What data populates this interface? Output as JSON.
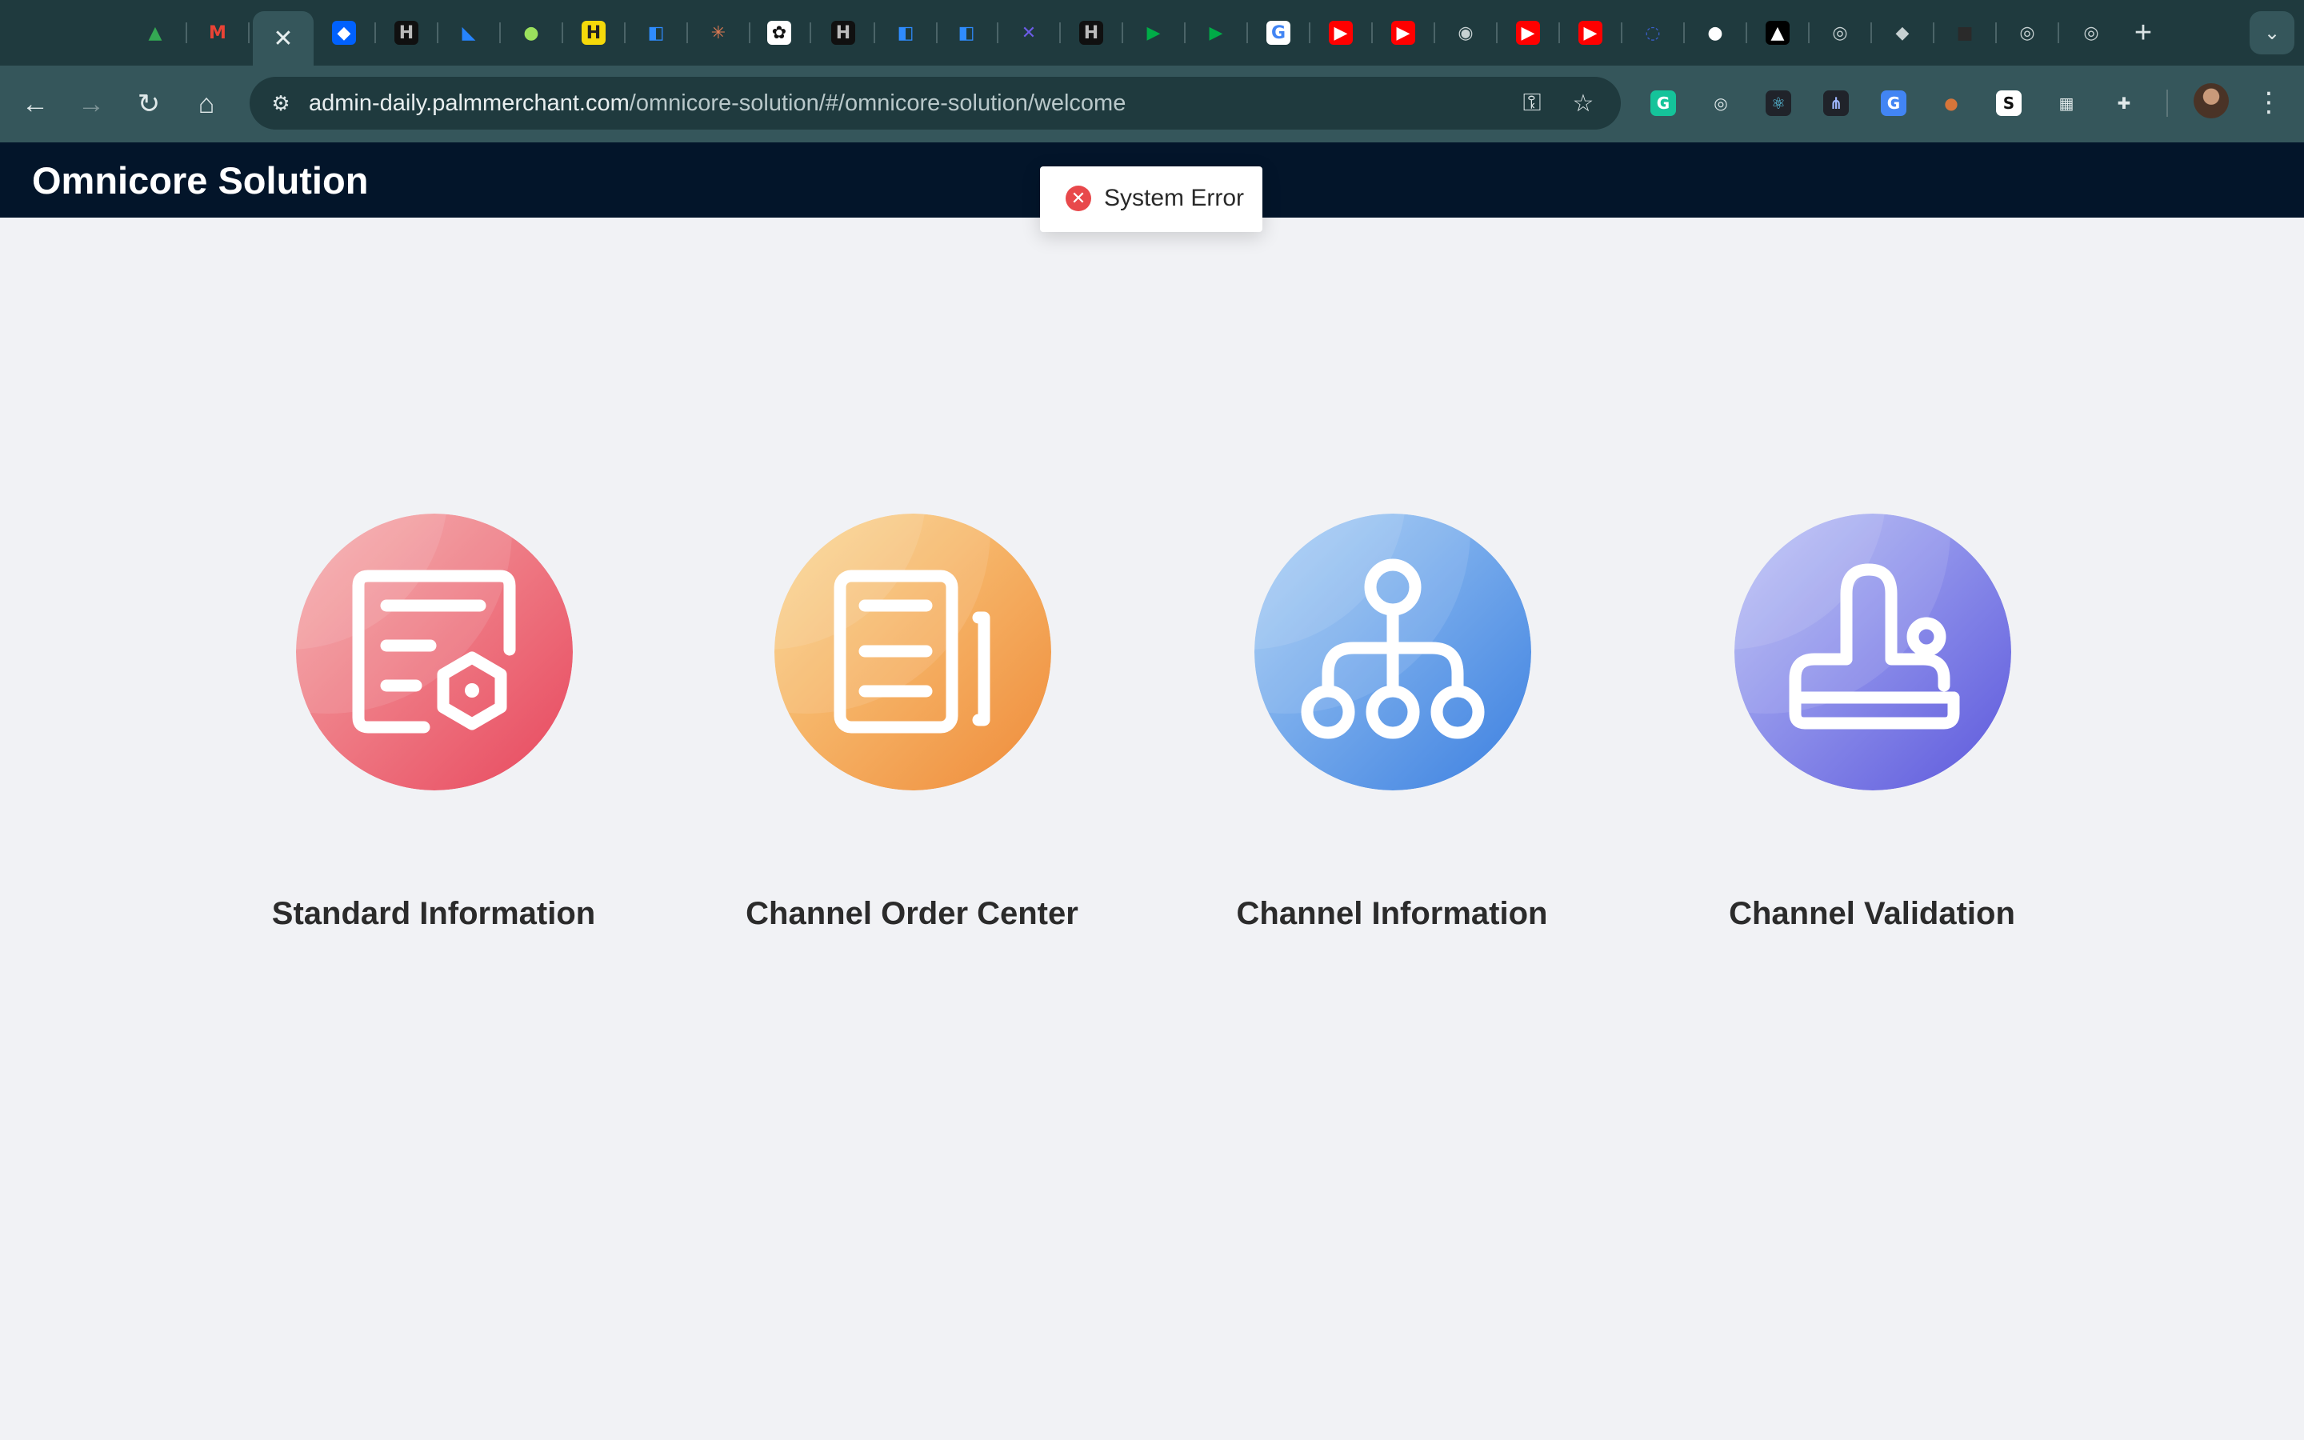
{
  "browser": {
    "active_tab_close": "✕",
    "tabs": [
      {
        "icon": "google-drive-icon",
        "glyph": "▲",
        "bg": "transparent",
        "fg": "#34a853"
      },
      {
        "icon": "gmail-icon",
        "glyph": "M",
        "bg": "transparent",
        "fg": "#ea4335"
      },
      {
        "icon": "dropbox-icon",
        "glyph": "◆",
        "bg": "#0061fe",
        "fg": "#ffffff"
      },
      {
        "icon": "notion-like-icon",
        "glyph": "H",
        "bg": "#101010",
        "fg": "#bbbbbb"
      },
      {
        "icon": "jira-icon",
        "glyph": "◣",
        "bg": "transparent",
        "fg": "#2684ff"
      },
      {
        "icon": "green-globe-icon",
        "glyph": "●",
        "bg": "transparent",
        "fg": "#9be15d"
      },
      {
        "icon": "yellow-h-icon",
        "glyph": "H",
        "bg": "#f5d90a",
        "fg": "#222222"
      },
      {
        "icon": "azure-devops-icon",
        "glyph": "◧",
        "bg": "transparent",
        "fg": "#2f8cff"
      },
      {
        "icon": "asterisk-icon",
        "glyph": "✳",
        "bg": "transparent",
        "fg": "#e07b53"
      },
      {
        "icon": "openai-icon",
        "glyph": "✿",
        "bg": "#ffffff",
        "fg": "#111111"
      },
      {
        "icon": "notion-like-icon",
        "glyph": "H",
        "bg": "#101010",
        "fg": "#bbbbbb"
      },
      {
        "icon": "azure-devops-icon",
        "glyph": "◧",
        "bg": "transparent",
        "fg": "#2f8cff"
      },
      {
        "icon": "azure-devops-icon",
        "glyph": "◧",
        "bg": "transparent",
        "fg": "#2f8cff"
      },
      {
        "icon": "x-cross-icon",
        "glyph": "✕",
        "bg": "transparent",
        "fg": "#6c5ce7"
      },
      {
        "icon": "notion-like-icon",
        "glyph": "H",
        "bg": "#101010",
        "fg": "#bbbbbb"
      },
      {
        "icon": "google-meet-icon",
        "glyph": "▶",
        "bg": "transparent",
        "fg": "#00ac47"
      },
      {
        "icon": "google-meet-icon",
        "glyph": "▶",
        "bg": "transparent",
        "fg": "#00ac47"
      },
      {
        "icon": "google-icon",
        "glyph": "G",
        "bg": "#ffffff",
        "fg": "#4285f4"
      },
      {
        "icon": "youtube-icon",
        "glyph": "▶",
        "bg": "#ff0000",
        "fg": "#ffffff"
      },
      {
        "icon": "youtube-icon",
        "glyph": "▶",
        "bg": "#ff0000",
        "fg": "#ffffff"
      },
      {
        "icon": "globe-icon",
        "glyph": "◉",
        "bg": "transparent",
        "fg": "#c7d1d2"
      },
      {
        "icon": "youtube-icon",
        "glyph": "▶",
        "bg": "#ff0000",
        "fg": "#ffffff"
      },
      {
        "icon": "youtube-icon",
        "glyph": "▶",
        "bg": "#ff0000",
        "fg": "#ffffff"
      },
      {
        "icon": "loading-icon",
        "glyph": "◌",
        "bg": "transparent",
        "fg": "#3a5fcd"
      },
      {
        "icon": "github-icon",
        "glyph": "●",
        "bg": "transparent",
        "fg": "#ffffff"
      },
      {
        "icon": "vercel-icon",
        "glyph": "▲",
        "bg": "#000000",
        "fg": "#ffffff"
      },
      {
        "icon": "chrome-icon",
        "glyph": "◎",
        "bg": "transparent",
        "fg": "#c7d1d2"
      },
      {
        "icon": "tag-icon",
        "glyph": "◆",
        "bg": "transparent",
        "fg": "#c7d1d2"
      },
      {
        "icon": "dark-square-icon",
        "glyph": "■",
        "bg": "transparent",
        "fg": "#2a2a2a"
      },
      {
        "icon": "chrome-icon",
        "glyph": "◎",
        "bg": "transparent",
        "fg": "#c7d1d2"
      },
      {
        "icon": "chrome-icon",
        "glyph": "◎",
        "bg": "transparent",
        "fg": "#c7d1d2"
      }
    ],
    "new_tab": "+",
    "tab_search": "⌄",
    "back": "←",
    "forward": "→",
    "reload": "↻",
    "home": "⌂",
    "site_info": "⚙",
    "url_host": "admin-daily.palmmerchant.com",
    "url_path": "/omnicore-solution/#/omnicore-solution/welcome",
    "password_key": "⚿",
    "bookmark_star": "☆",
    "extensions": [
      {
        "icon": "grammarly-icon",
        "glyph": "G",
        "bg": "#15c39a",
        "fg": "#ffffff"
      },
      {
        "icon": "target-icon",
        "glyph": "◎",
        "bg": "transparent",
        "fg": "#dfe8e9"
      },
      {
        "icon": "react-devtools-icon",
        "glyph": "⚛",
        "bg": "#20232a",
        "fg": "#61dafb"
      },
      {
        "icon": "network-icon",
        "glyph": "⋔",
        "bg": "#20232a",
        "fg": "#9fb7ff"
      },
      {
        "icon": "google-translate-icon",
        "glyph": "G",
        "bg": "#4285f4",
        "fg": "#ffffff"
      },
      {
        "icon": "cookie-icon",
        "glyph": "●",
        "bg": "transparent",
        "fg": "#d6753a"
      },
      {
        "icon": "s-icon",
        "glyph": "S",
        "bg": "#ffffff",
        "fg": "#111111"
      },
      {
        "icon": "grid-icon",
        "glyph": "▦",
        "bg": "transparent",
        "fg": "#dfe8e9"
      },
      {
        "icon": "puzzle-icon",
        "glyph": "✚",
        "bg": "transparent",
        "fg": "#dfe8e9"
      }
    ],
    "menu": "⋮"
  },
  "app": {
    "title": "Omnicore Solution",
    "toast": {
      "icon_glyph": "✕",
      "message": "System Error"
    },
    "cards": [
      {
        "label": "Standard Information",
        "icon": "document-settings-icon",
        "colors": {
          "a": "#f4a7a6",
          "b": "#ef7a7e",
          "c": "#e8485e"
        }
      },
      {
        "label": "Channel Order Center",
        "icon": "documents-icon",
        "colors": {
          "a": "#fbd58c",
          "b": "#f3b469",
          "c": "#ef8b3a"
        }
      },
      {
        "label": "Channel Information",
        "icon": "hierarchy-network-icon",
        "colors": {
          "a": "#a5cdf5",
          "b": "#6fa8ea",
          "c": "#3d80e0"
        }
      },
      {
        "label": "Channel Validation",
        "icon": "stamp-icon",
        "colors": {
          "a": "#b6bff6",
          "b": "#8e94ec",
          "c": "#5d58dc"
        }
      }
    ]
  }
}
